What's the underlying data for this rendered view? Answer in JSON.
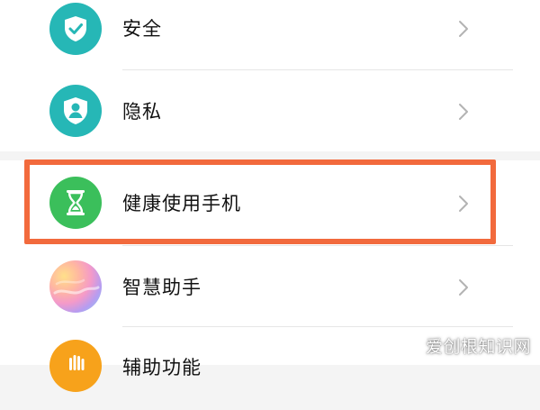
{
  "settings": {
    "items": [
      {
        "label": "安全",
        "icon": "shield-check-icon",
        "color": "#26b7b6"
      },
      {
        "label": "隐私",
        "icon": "privacy-shield-icon",
        "color": "#26b7b6"
      },
      {
        "label": "健康使用手机",
        "icon": "hourglass-icon",
        "color": "#3bbf5b"
      },
      {
        "label": "智慧助手",
        "icon": "gradient-orb-icon",
        "color": "#f4a3c8"
      },
      {
        "label": "辅助功能",
        "icon": "hand-icon",
        "color": "#f7a21b"
      }
    ]
  },
  "highlight": {
    "color": "#f26a3d"
  },
  "watermark": "爱创根知识网"
}
